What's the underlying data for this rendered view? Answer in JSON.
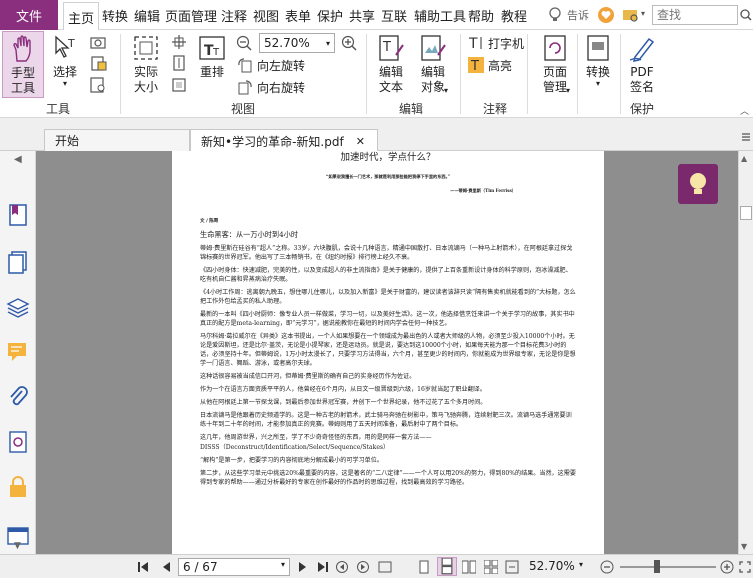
{
  "menubar": {
    "file": "文件",
    "items": [
      "主页",
      "转换",
      "编辑",
      "页面管理",
      "注释",
      "视图",
      "表单",
      "保护",
      "共享",
      "互联",
      "辅助工具",
      "帮助",
      "教程"
    ],
    "tell_me": "告诉",
    "search_placeholder": "查找"
  },
  "ribbon": {
    "tools_group": {
      "label": "工具",
      "hand": "手型\n工具",
      "select": "选择"
    },
    "view_group": {
      "label": "视图",
      "actual": "实际\n大小",
      "reflow": "重排",
      "zoom": "52.70%",
      "rotate_left": "向左旋转",
      "rotate_right": "向右旋转"
    },
    "edit_group": {
      "label": "编辑",
      "edit_text": "编辑\n文本",
      "edit_object": "编辑\n对象"
    },
    "comment_group": {
      "label": "注释",
      "typewriter": "打字机",
      "highlight": "高亮"
    },
    "page_mgmt": "页面\n管理",
    "convert": "转换",
    "protect_group": {
      "label": "保护",
      "pdf_sign": "PDF\n签名"
    }
  },
  "tabs": {
    "start": "开始",
    "doc": "新知•学习的革命-新知.pdf"
  },
  "page": {
    "heading": "加速时代，学点什么？",
    "quote": "“如果说我擅长一门艺术，那就是利用那些能把我停下手里的东西。”",
    "quote_author": "——蒂姆·费里斯（Tim Ferriss）",
    "byline": "文 / 陈哥",
    "section_title": "生命黑客：从一万小时到4小时",
    "paragraphs": [
      "蒂姆·费里斯在硅谷有“超人”之称。33岁，六块腹肌，会说十几种语言，精通中国散打、日本流镝马（一种马上射箭术），在阿根廷拿过探戈锦标赛的世界冠军。他出写了三本畅销书，在《纽约时报》排行榜上经久不衰。",
      "《四小时身体：快速减肥，完美的性，以及变成超人的非主流指南》是关于健康的，提供了上百条重新设计身体的科学原则，泡冰澡减肥、吃有机自仁酱和昇蒸病治疗失眠。",
      "《4小时工作周：逃离朝九晚五，想住哪儿住哪儿，以及加入新富》是关于财富的，建议读者该辞只读“隔有售卖机就能看到的”大标题，怎么把工作外包给孟买的私人助理。",
      "最新的一本叫《四小时厨师：像专业人员一样做菜，学习一切，以及美好生活》。这一次，他选择借烹饪来讲一个关于学习的故事，其实书中真正的配方是meta-learning，即“元学习”，据说能教你在最短的时间内学会任何一种技艺。",
      "马尔科姆·葛拉威尔在《异类》这本书提出，一个人如果想要在一个领域成为最出色的人或者大师级的人物，必须至少投入10000个小时。无论是爱因斯坦，还是比尔·盖茨，无论是小提琴家，还是运动员。就是说，要达到这10000个小时，如果每天能为那一个目标花费3小时的话，必须坚持十年。但蒂姆说，1万小时太漫长了，只要学习方法得当，六个月，甚至更少的时间内，你就能成为世界级专家，无论是你是想学一门语言、舞蹈、游泳，或者高尔夫球。",
      "这种话很容易被当成信口开河，但蒂姆·费里斯的确有自己的实身经历作为佐证。",
      "作为一个在语言方面资质平平的人，他曾经在6个月内，从日文一级晋级到六级，16岁就当起了职业翻译。",
      "从他在阿根廷上第一节探戈课，到最后参加世界冠军赛，并创下一个世界纪录，他不过花了五个多月时间。",
      "日本流镝马是他跟着历史频道学的。这是一种古老的射箭术，武士骑马奔驰在树影中，策马飞驰奔腾，连续射靶三次。流镝马选手通常要训练十年到二十年的时间，才能参加真正的竞赛。蒂姆则用了五天时间准备，最后射中了两个目标。",
      "这几年，他周游世界，兴之所至，学了不少奇奇怪怪的东西，用的是同样一套方法——",
      "DISSS（Deconstruct/Identification/Select/Sequence/Stakes）",
      "“解构”是第一步，把要学习的内容彻底地分解成最小的可学习单位。",
      "第二步，从这些学习单元中挑选20%最重要的内容，这是著名的“二八定律”——一个人可以用20%的努力，得到80%的结果。当然，这需要得到专家的帮助——通过分析最好的专家在创作最好的作品时的思维过程，找到最高效的学习路径。"
    ]
  },
  "status": {
    "page": "6 / 67",
    "zoom": "52.70%"
  },
  "colors": {
    "brand": "#8a2e7e",
    "doc_bg": "#8e8e8e"
  }
}
